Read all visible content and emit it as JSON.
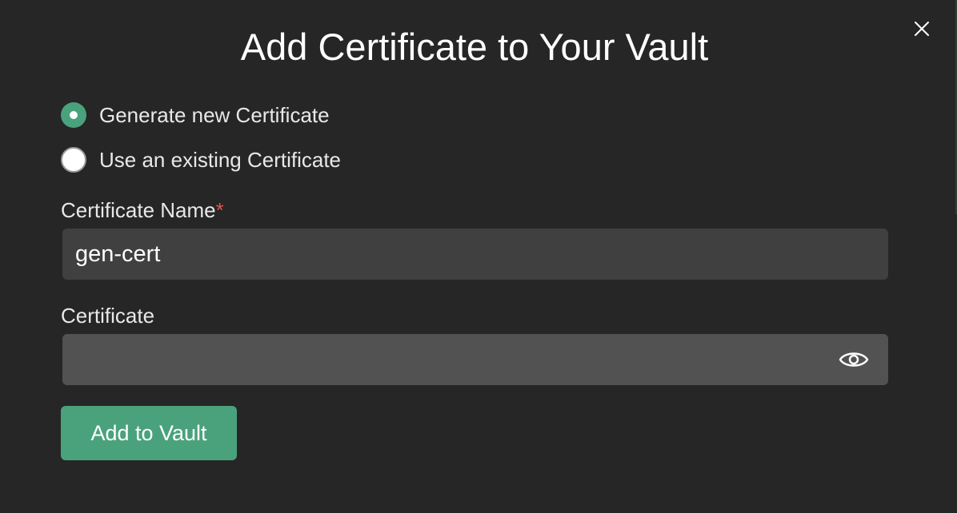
{
  "dialog": {
    "title": "Add Certificate to Your Vault",
    "close_icon": "close-icon"
  },
  "options": [
    {
      "label": "Generate new Certificate",
      "selected": true
    },
    {
      "label": "Use an existing Certificate",
      "selected": false
    }
  ],
  "certificate_name": {
    "label": "Certificate Name",
    "required_marker": "*",
    "value": "gen-cert"
  },
  "certificate": {
    "label": "Certificate",
    "value": "",
    "toggle_icon": "eye-icon"
  },
  "submit": {
    "label": "Add to Vault"
  },
  "colors": {
    "background": "#262626",
    "accent": "#4aa27c",
    "required": "#e0524c",
    "input_bg": "#404040",
    "input_bg_alt": "#525252"
  }
}
